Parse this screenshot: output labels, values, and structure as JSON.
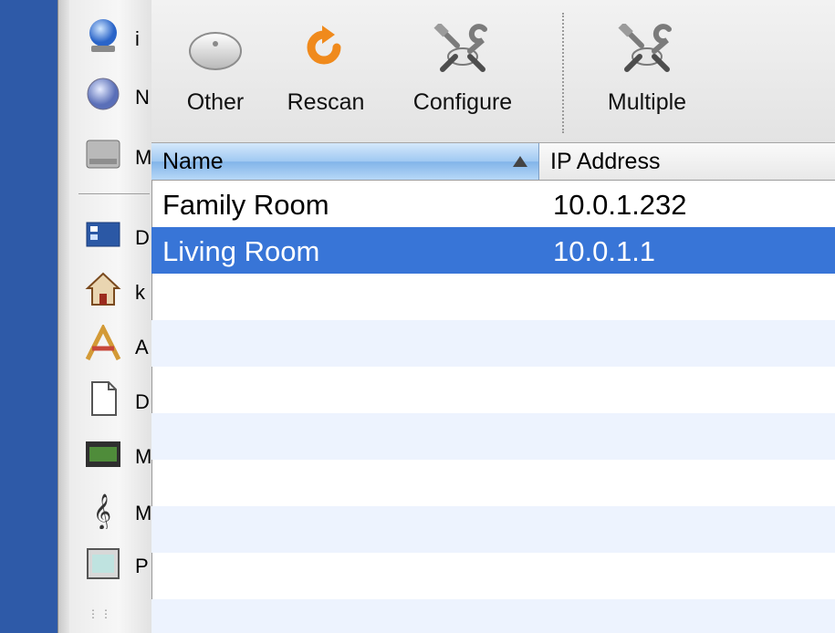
{
  "sidebar": {
    "items": [
      {
        "icon": "globe-network-icon",
        "label": "i"
      },
      {
        "icon": "network-globe-icon",
        "label": "N"
      },
      {
        "icon": "hard-drive-icon",
        "label": "M"
      },
      {
        "icon": "desktop-icon",
        "label": "D"
      },
      {
        "icon": "home-icon",
        "label": "k"
      },
      {
        "icon": "applications-icon",
        "label": "A"
      },
      {
        "icon": "documents-icon",
        "label": "D"
      },
      {
        "icon": "movies-icon",
        "label": "M"
      },
      {
        "icon": "music-icon",
        "label": "M"
      },
      {
        "icon": "pictures-icon",
        "label": "P"
      }
    ]
  },
  "toolbar": {
    "other_label": "Other",
    "rescan_label": "Rescan",
    "configure_label": "Configure",
    "multiple_label": "Multiple"
  },
  "table": {
    "columns": [
      "Name",
      "IP Address"
    ],
    "sort_column": "Name",
    "rows": [
      {
        "name": "Family Room",
        "ip": "10.0.1.232",
        "selected": false
      },
      {
        "name": "Living Room",
        "ip": "10.0.1.1",
        "selected": true
      }
    ]
  },
  "colors": {
    "selection": "#3875d7",
    "alt_row": "#edf3fe",
    "rescan_orange": "#f08a1c",
    "desktop_blue": "#2e5aa8"
  }
}
